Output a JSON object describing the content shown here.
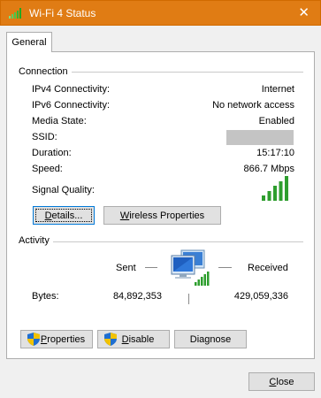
{
  "window": {
    "title": "Wi-Fi 4 Status",
    "close_glyph": "✕"
  },
  "tabs": [
    {
      "label": "General"
    }
  ],
  "connection": {
    "heading": "Connection",
    "rows": [
      {
        "label": "IPv4 Connectivity:",
        "value": "Internet"
      },
      {
        "label": "IPv6 Connectivity:",
        "value": "No network access"
      },
      {
        "label": "Media State:",
        "value": "Enabled"
      },
      {
        "label": "SSID:",
        "value": ""
      },
      {
        "label": "Duration:",
        "value": "15:17:10"
      },
      {
        "label": "Speed:",
        "value": "866.7 Mbps"
      }
    ],
    "signal_label": "Signal Quality:",
    "signal_bars": 5,
    "signal_max": 5,
    "details_button": {
      "prefix": "",
      "accel": "D",
      "rest": "etails..."
    },
    "wireless_button": {
      "prefix": "",
      "accel": "W",
      "rest": "ireless Properties"
    }
  },
  "activity": {
    "heading": "Activity",
    "sent_label": "Sent",
    "received_label": "Received",
    "bytes_label": "Bytes:",
    "bytes_sent": "84,892,353",
    "bytes_received": "429,059,336"
  },
  "buttons": {
    "properties": {
      "prefix": "",
      "accel": "P",
      "rest": "roperties"
    },
    "disable": {
      "prefix": "",
      "accel": "D",
      "rest": "isable"
    },
    "diagnose": {
      "prefix": "Dia",
      "accel": "g",
      "rest": "nose"
    },
    "close": {
      "prefix": "",
      "accel": "C",
      "rest": "lose"
    }
  },
  "colors": {
    "titlebar": "#e07c14",
    "signal": "#2e9e2e",
    "focus": "#0078d7"
  },
  "icons": {
    "window": "wifi-signal-icon",
    "network": "network-computer-icon",
    "shield": "uac-shield-icon"
  }
}
